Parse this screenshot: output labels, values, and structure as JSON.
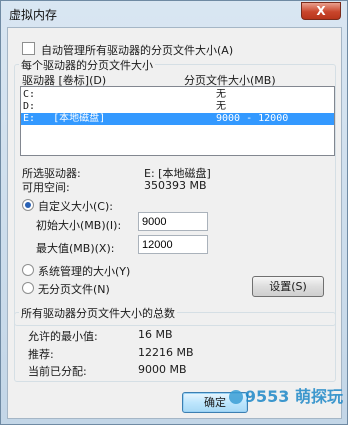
{
  "window": {
    "title": "虚拟内存",
    "close_glyph": "X"
  },
  "auto_manage": {
    "label": "自动管理所有驱动器的分页文件大小(A)",
    "checked": false
  },
  "per_drive_group": {
    "title": "每个驱动器的分页文件大小",
    "col_drive": "驱动器 [卷标](D)",
    "col_size": "分页文件大小(MB)",
    "rows": [
      {
        "drive": "C:",
        "size": "无",
        "selected": false
      },
      {
        "drive": "D:",
        "size": "无",
        "selected": false
      },
      {
        "drive": "E:   [本地磁盘]",
        "size": "9000 - 12000",
        "selected": true
      }
    ],
    "selected_drive_label": "所选驱动器:",
    "selected_drive_value": "E:  [本地磁盘]",
    "free_space_label": "可用空间:",
    "free_space_value": "350393 MB",
    "custom_size_label": "自定义大小(C):",
    "initial_size_label": "初始大小(MB)(I):",
    "initial_size_value": "9000",
    "max_size_label": "最大值(MB)(X):",
    "max_size_value": "12000",
    "system_managed_label": "系统管理的大小(Y)",
    "no_paging_label": "无分页文件(N)",
    "set_button": "设置(S)"
  },
  "totals_group": {
    "title": "所有驱动器分页文件大小的总数",
    "min_label": "允许的最小值:",
    "min_value": "16 MB",
    "recommended_label": "推荐:",
    "recommended_value": "12216 MB",
    "current_label": "当前已分配:",
    "current_value": "9000 MB"
  },
  "buttons": {
    "ok": "确定"
  },
  "watermark": "9553 萌探玩"
}
